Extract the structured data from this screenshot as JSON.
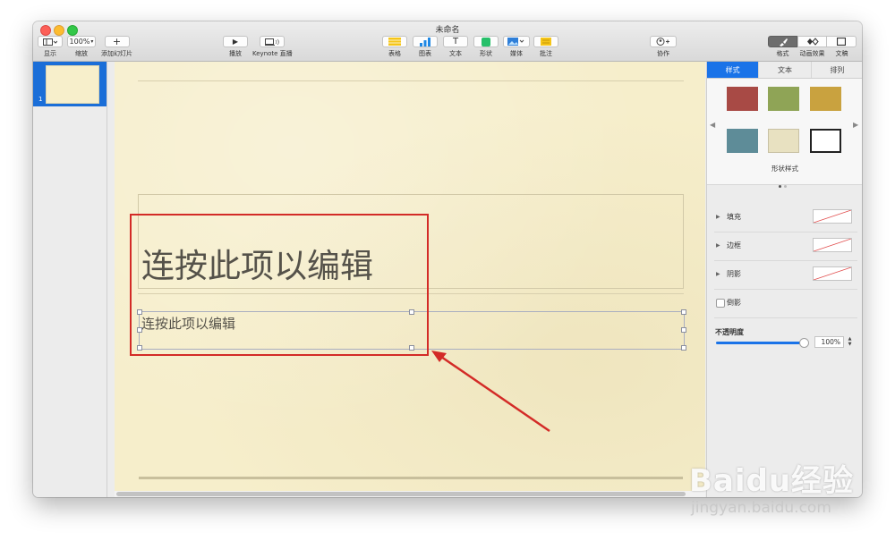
{
  "window": {
    "title": "未命名"
  },
  "toolbar": {
    "view_label": "显示",
    "zoom_value": "100%",
    "zoom_label": "缩放",
    "add_slide_label": "添加幻灯片",
    "play_label": "播放",
    "keynote_live_label": "Keynote 直播",
    "table_label": "表格",
    "chart_label": "图表",
    "text_label": "文本",
    "shape_label": "形状",
    "media_label": "媒体",
    "comment_label": "批注",
    "collaborate_label": "协作",
    "format_label": "格式",
    "animate_label": "动画效果",
    "document_label": "文稿"
  },
  "navigator": {
    "slide_number": "1"
  },
  "slide": {
    "title_placeholder": "连按此项以编辑",
    "body_placeholder": "连按此项以编辑",
    "background_color": "#f6eecb"
  },
  "inspector": {
    "tabs": [
      "样式",
      "文本",
      "排列"
    ],
    "active_tab": "样式",
    "shape_styles_label": "形状样式",
    "swatches": [
      {
        "color": "#a84a45"
      },
      {
        "color": "#8fa456"
      },
      {
        "color": "#c9a23f"
      },
      {
        "color": "#5e8c98"
      },
      {
        "color": "#e8e1c1"
      },
      {
        "color": "#ffffff"
      }
    ],
    "fill_label": "填充",
    "border_label": "边框",
    "shadow_label": "阴影",
    "reflection_label": "倒影",
    "opacity_label": "不透明度",
    "opacity_value": "100%"
  },
  "watermark": {
    "line1": "Baidu经验",
    "line2": "jingyan.baidu.com"
  },
  "colors": {
    "accent": "#1a73e8",
    "annotation": "#d32b27"
  }
}
